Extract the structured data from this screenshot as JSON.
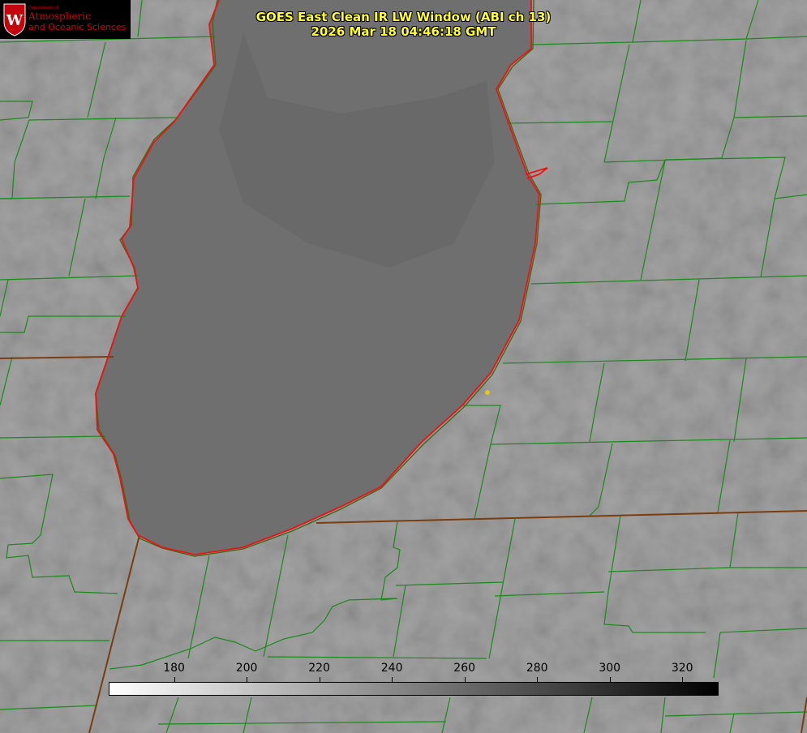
{
  "title": {
    "line1": "GOES East Clean IR LW Window (ABI ch 13)",
    "line2": "2026 Mar 18 04:46:18 GMT"
  },
  "logo": {
    "dept": "Department of",
    "line1": "Atmospheric",
    "line2": "and Oceanic Sciences",
    "seal_letter": "W",
    "color": "#c5050c"
  },
  "colorbar": {
    "ticks": [
      "180",
      "200",
      "220",
      "240",
      "260",
      "280",
      "300",
      "320"
    ],
    "range": [
      162,
      330
    ],
    "from_color": "#ffffff",
    "to_color": "#000000"
  },
  "colors": {
    "county_lines": "#1a8a1a",
    "coastline": "#ee1111",
    "state_line": "#7a3d10",
    "marker": "#e6c619"
  }
}
